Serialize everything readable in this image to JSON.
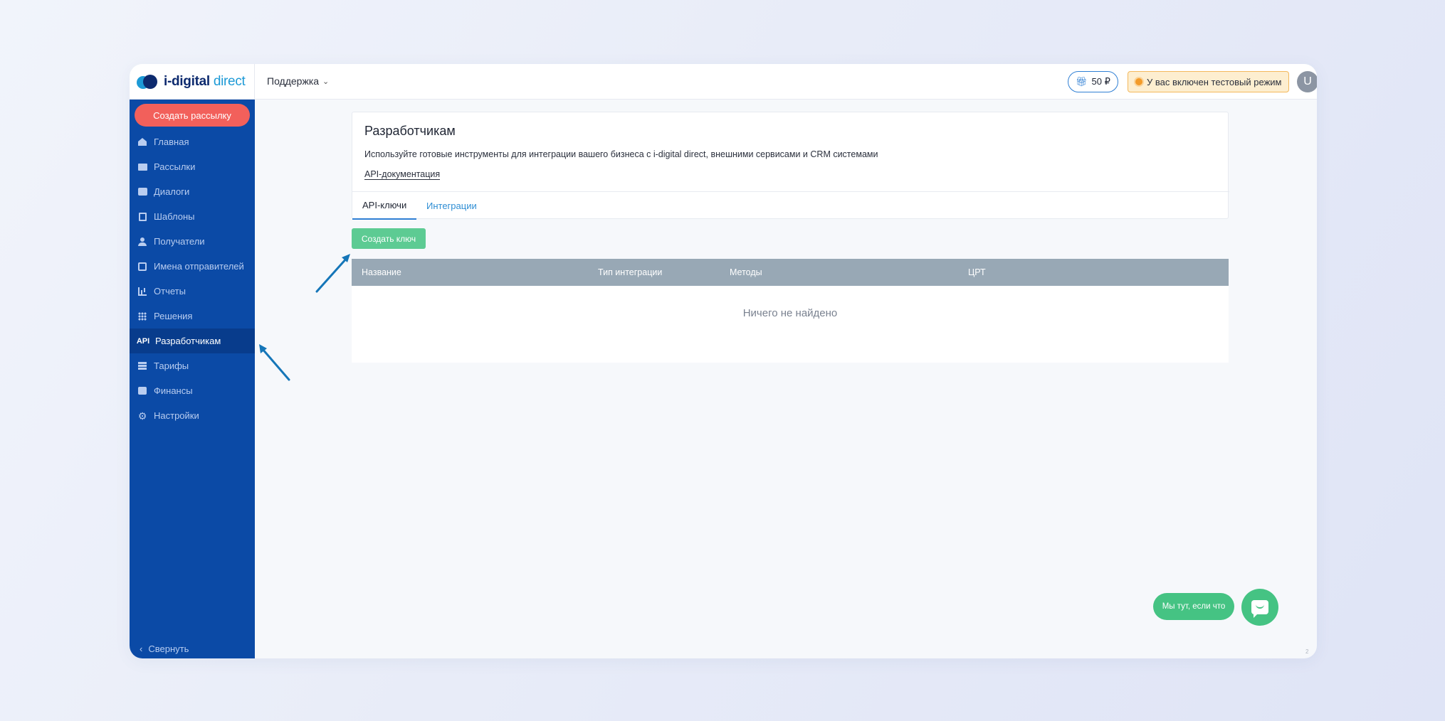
{
  "app": {
    "logo_main": "i-digital",
    "logo_accent": "direct"
  },
  "header": {
    "support_label": "Поддержка",
    "balance": "50 ₽",
    "test_mode": "У вас включен тестовый режим",
    "avatar_letter": "U"
  },
  "sidebar": {
    "create_button": "Создать рассылку",
    "items": [
      {
        "label": "Главная",
        "icon": "home-icon"
      },
      {
        "label": "Рассылки",
        "icon": "mail-icon"
      },
      {
        "label": "Диалоги",
        "icon": "chat-icon"
      },
      {
        "label": "Шаблоны",
        "icon": "template-icon"
      },
      {
        "label": "Получатели",
        "icon": "user-icon"
      },
      {
        "label": "Имена отправителей",
        "icon": "senders-icon"
      },
      {
        "label": "Отчеты",
        "icon": "bar-chart-icon"
      },
      {
        "label": "Решения",
        "icon": "grid-icon"
      },
      {
        "label": "Разработчикам",
        "icon": "api-icon",
        "icon_text": "API",
        "active": true
      },
      {
        "label": "Тарифы",
        "icon": "table-icon"
      },
      {
        "label": "Финансы",
        "icon": "wallet-icon"
      },
      {
        "label": "Настройки",
        "icon": "gear-icon"
      }
    ],
    "collapse_label": "Свернуть"
  },
  "main": {
    "title": "Разработчикам",
    "description": "Используйте готовые инструменты для интеграции вашего бизнеса с i-digital direct, внешними сервисами и CRM системами",
    "doc_link": "API-документация",
    "tabs": [
      {
        "label": "API-ключи",
        "active": true
      },
      {
        "label": "Интеграции",
        "active": false
      }
    ],
    "create_key_button": "Создать ключ",
    "table": {
      "columns": [
        "Название",
        "Тип интеграции",
        "Методы",
        "ЦРТ"
      ],
      "empty_text": "Ничего не найдено"
    }
  },
  "chat": {
    "pill_text": "Мы тут, если что"
  },
  "page_number": "2",
  "colors": {
    "sidebar": "#0b4aa6",
    "accent_red": "#f2605b",
    "accent_green": "#5dcb93",
    "accent_blue": "#2f7fd4",
    "table_header": "#98a8b5",
    "annotation_arrow": "#1576b8"
  }
}
